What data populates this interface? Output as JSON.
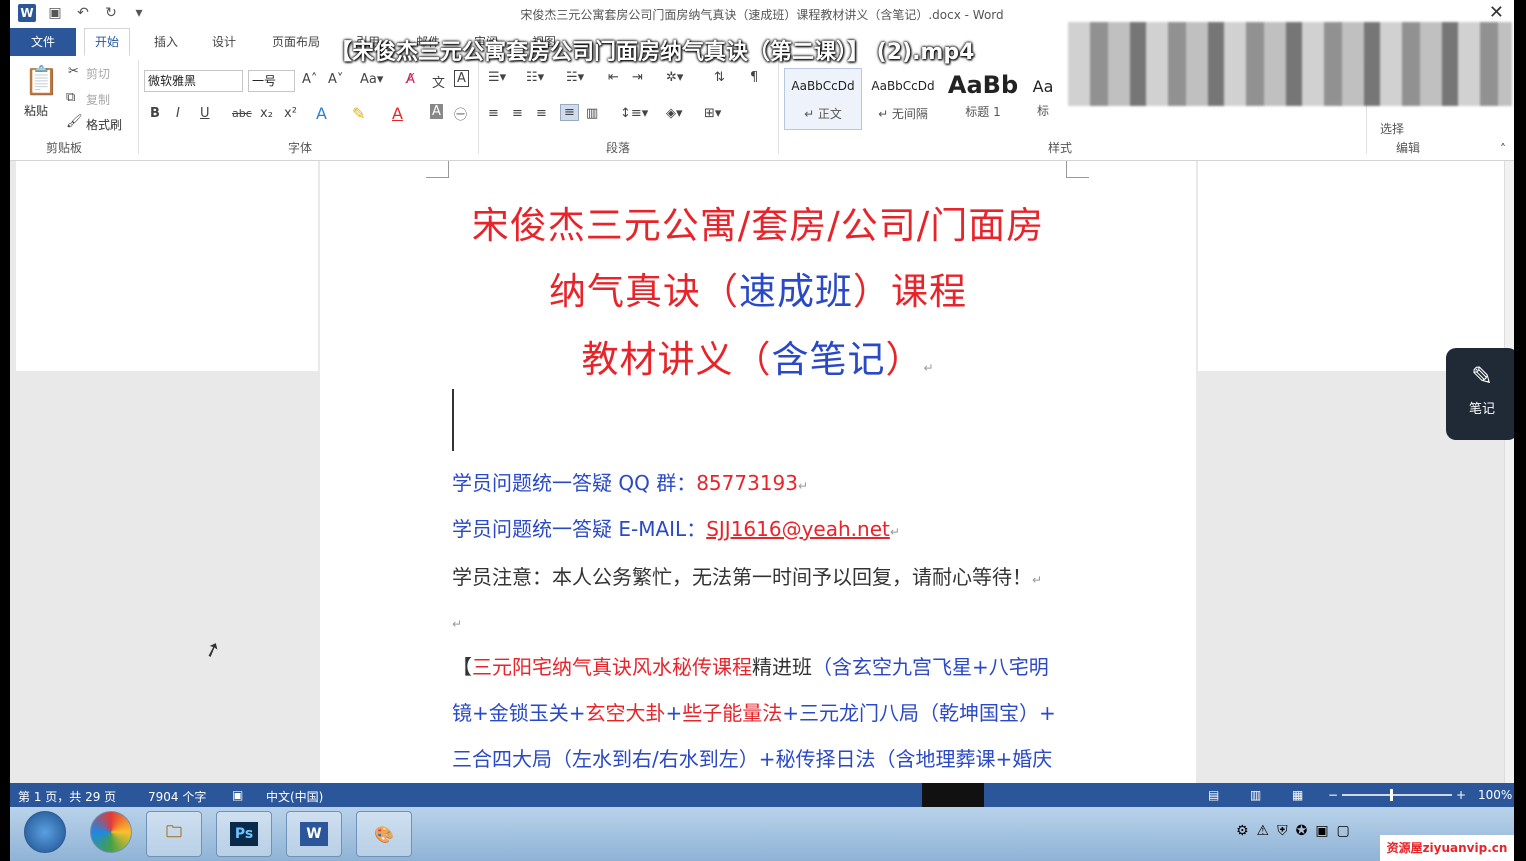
{
  "app": {
    "window_title": "宋俊杰三元公寓套房公司门面房纳气真诀（速成班）课程教材讲义（含笔记）.docx - Word",
    "video_overlay_title": "【宋俊杰三元公寓套房公司门面房纳气真诀（第二课）】 (2).mp4"
  },
  "tabs": [
    "文件",
    "开始",
    "插入",
    "设计",
    "页面布局",
    "引用",
    "邮件",
    "审阅",
    "视图"
  ],
  "ribbon": {
    "clipboard": {
      "paste": "粘贴",
      "cut": "剪切",
      "copy": "复制",
      "format_painter": "格式刷",
      "label": "剪贴板"
    },
    "font": {
      "name": "微软雅黑",
      "size": "一号",
      "label": "字体",
      "bold": "B",
      "italic": "I",
      "underline": "U",
      "strike": "abc",
      "sub": "x₂",
      "sup": "x²"
    },
    "paragraph": {
      "label": "段落"
    },
    "styles": {
      "label": "样式",
      "items": [
        {
          "preview": "AaBbCcDd",
          "name": "↵ 正文"
        },
        {
          "preview": "AaBbCcDd",
          "name": "↵ 无间隔"
        },
        {
          "preview": "AaBb",
          "name": "标题 1"
        },
        {
          "preview": "Aa",
          "name": "标"
        }
      ]
    },
    "editing": {
      "select": "选择",
      "label": "编辑"
    }
  },
  "document": {
    "title_line1": "宋俊杰三元公寓/套房/公司/门面房",
    "title_line2_a": "纳气真诀（",
    "title_line2_b": "速成班",
    "title_line2_c": "）课程",
    "title_line3_a": "教材讲义（",
    "title_line3_b": "含笔记",
    "title_line3_c": "）",
    "qq_label": "学员问题统一答疑 QQ 群：",
    "qq_value": "85773193",
    "email_label": "学员问题统一答疑 E-MAIL：",
    "email_value": "SJJ1616@yeah.net",
    "notice": "学员注意：本人公务繁忙，无法第一时间予以回复，请耐心等待！",
    "course_bracket": "【",
    "course_red": "三元阳宅纳气真诀风水秘传课程",
    "course_dark": "精进班",
    "course_blue1": "（含玄空九宫飞星+八宅明",
    "course_line2_a": "镜+金锁玉关+",
    "course_line2_red1": "玄空大卦",
    "course_line2_b": "+",
    "course_line2_red2": "些子能量法",
    "course_line2_c": "+三元龙门八局（乾坤国宝）+",
    "course_line3": "三合四大局（左水到右/右水到左）+秘传择日法（含地理葬课+婚庆"
  },
  "notes_button": "笔记",
  "statusbar": {
    "page": "第 1 页，共 29 页",
    "words": "7904 个字",
    "language": "中文(中国)",
    "zoom": "100%"
  },
  "watermark": "资源屋ziyuanvip.cn",
  "colors": {
    "word_blue": "#2b579a",
    "title_red": "#e8242b",
    "text_blue": "#2a49c7"
  }
}
